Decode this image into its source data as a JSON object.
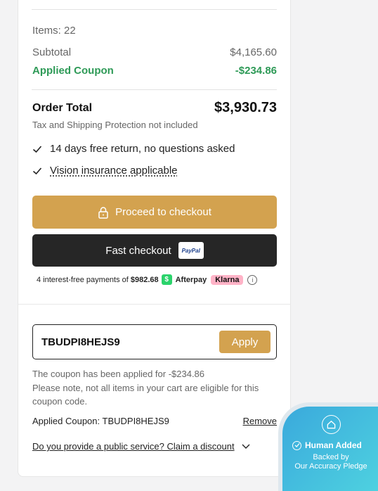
{
  "summary": {
    "items_label": "Items: 22",
    "subtotal_label": "Subtotal",
    "subtotal_value": "$4,165.60",
    "coupon_label": "Applied Coupon",
    "coupon_value": "-$234.86",
    "order_total_label": "Order Total",
    "order_total_value": "$3,930.73",
    "tax_note": "Tax and Shipping Protection not included"
  },
  "benefits": [
    {
      "text": "14 days free return, no questions asked"
    },
    {
      "text": "Vision insurance applicable"
    }
  ],
  "buttons": {
    "checkout_label": "Proceed to checkout",
    "fast_checkout_label": "Fast checkout",
    "paypal_label": "PayPal"
  },
  "payments": {
    "text": "4 interest-free payments of",
    "amount": "$982.68",
    "afterpay_icon": "$",
    "afterpay_label": "Afterpay",
    "klarna_label": "Klarna",
    "info_icon": "i"
  },
  "coupon": {
    "code": "TBUDPI8HEJS9",
    "apply_label": "Apply",
    "message_line1": "The coupon has been applied for -$234.86",
    "message_line2": "Please note, not all items in your cart are eligible for this coupon code.",
    "applied_label": "Applied Coupon: TBUDPI8HEJS9",
    "remove_label": "Remove"
  },
  "public_service": {
    "label": "Do you provide a public service? Claim a discount"
  },
  "trust_badge": {
    "title": "Human Added",
    "line1": "Backed by",
    "line2": "Our Accuracy Pledge"
  },
  "colors": {
    "accent_gold": "#d3a24f",
    "coupon_green": "#2e9a57",
    "dark_button": "#262626",
    "badge_start": "#3aa9dc",
    "badge_end": "#4fd3e0"
  }
}
